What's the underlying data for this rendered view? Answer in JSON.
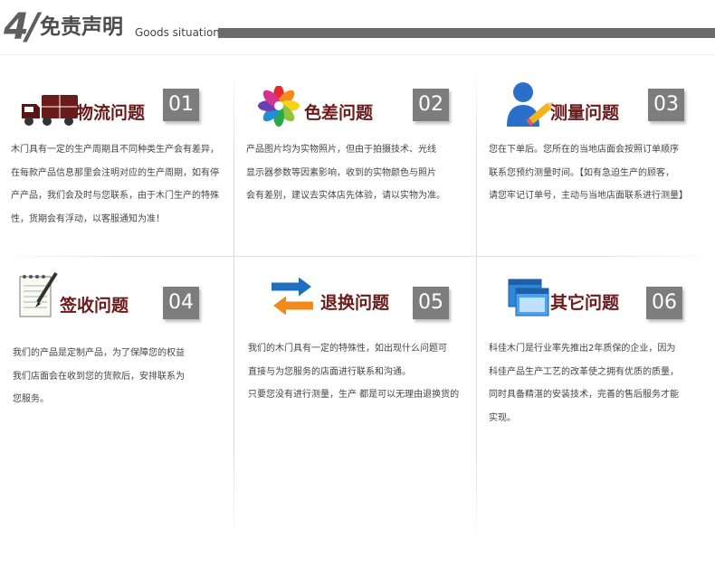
{
  "header": {
    "number": "4/",
    "title": "免责声明",
    "subtitle": "Goods situation"
  },
  "panels": [
    {
      "icon": "truck-icon",
      "title": "物流问题",
      "number": "01",
      "lines": [
        "木门具有一定的生产周期且不同种类生产会有差异，",
        "在每款产品信息那里会注明对应的生产周期，如有停",
        "产产品，我们会及时与您联系，由于木门生产的特殊",
        "性，货期会有浮动，以客服通知为准！"
      ]
    },
    {
      "icon": "color-wheel-icon",
      "title": "色差问题",
      "number": "02",
      "lines": [
        "产品图片均为实物照片，但由于拍摄技术、光线",
        "显示器参数等因素影响，收到的实物颜色与照片",
        "会有差别，建议去实体店先体验，请以实物为准。"
      ]
    },
    {
      "icon": "user-pencil-icon",
      "title": "测量问题",
      "number": "03",
      "lines": [
        "您在下单后。您所在的当地店面会按照订单顺序",
        "联系您预约测量时间。【如有急迫生产的顾客，",
        "请您牢记订单号，主动与当地店面联系进行测量】"
      ]
    },
    {
      "icon": "notepad-icon",
      "title": "签收问题",
      "number": "04",
      "lines": [
        "我们的产品是定制产品，为了保障您的权益",
        "我们店面会在收到您的货款后，安排联系为",
        "您服务。"
      ]
    },
    {
      "icon": "exchange-arrows-icon",
      "title": "退换问题",
      "number": "05",
      "lines": [
        "我们的木门具有一定的特殊性，如出现什么问题可",
        "直接与为您服务的店面进行联系和沟通。",
        "只要您没有进行测量，生产 都是可以无理由退换货的"
      ]
    },
    {
      "icon": "browser-window-icon",
      "title": "其它问题",
      "number": "06",
      "lines": [
        "科佳木门是行业率先推出2年质保的企业，因为",
        "科佳产品生产工艺的改革使之拥有优质的质量，",
        "同时具备精湛的安装技术，完善的售后服务才能",
        "实现。"
      ]
    }
  ]
}
